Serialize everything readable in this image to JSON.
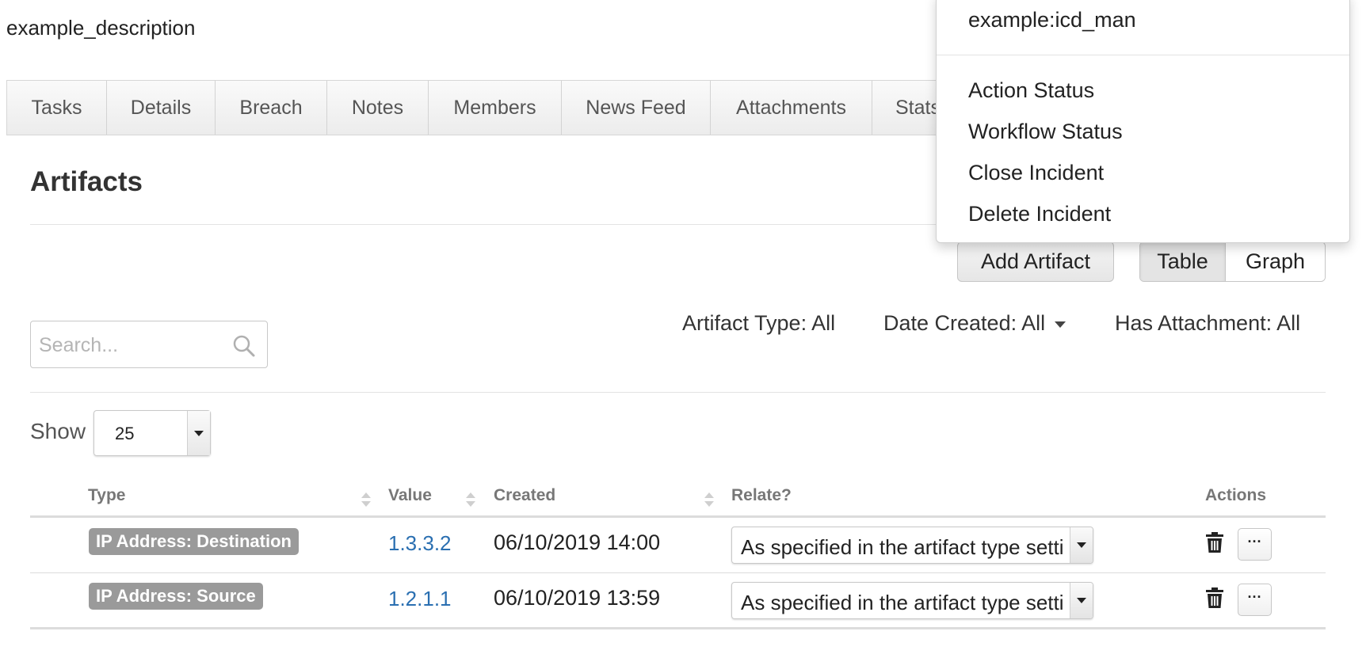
{
  "incident": {
    "description": "example_description"
  },
  "tabs": [
    "Tasks",
    "Details",
    "Breach",
    "Notes",
    "Members",
    "News Feed",
    "Attachments",
    "Stats"
  ],
  "section": {
    "title": "Artifacts"
  },
  "buttons": {
    "add_artifact": "Add Artifact",
    "view_table": "Table",
    "view_graph": "Graph"
  },
  "search": {
    "placeholder": "Search...",
    "icon": "search-icon"
  },
  "filters": {
    "artifact_type": "Artifact Type: All",
    "date_created": "Date Created: All",
    "has_attachment": "Has Attachment: All"
  },
  "pagination": {
    "show_label": "Show",
    "page_size": "25"
  },
  "table": {
    "columns": [
      "Type",
      "Value",
      "Created",
      "Relate?",
      "Actions"
    ],
    "rows": [
      {
        "type": "IP Address: Destination",
        "value": "1.3.3.2",
        "created": "06/10/2019 14:00",
        "relate": "As specified in the artifact type settings"
      },
      {
        "type": "IP Address: Source",
        "value": "1.2.1.1",
        "created": "06/10/2019 13:59",
        "relate": "As specified in the artifact type settings"
      }
    ],
    "more_label": "···"
  },
  "menu": {
    "user": "example:icd_man",
    "items": [
      "Action Status",
      "Workflow Status",
      "Close Incident",
      "Delete Incident"
    ]
  },
  "colors": {
    "link": "#2a6fb1",
    "badge": "#9a9a9a"
  }
}
